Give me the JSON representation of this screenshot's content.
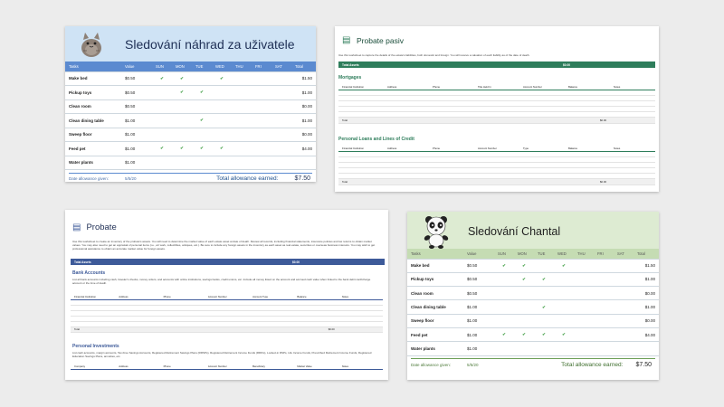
{
  "card1": {
    "title": "Sledování náhrad za uživatele",
    "columns": [
      "Tasks",
      "Value",
      "SUN",
      "MON",
      "TUE",
      "WED",
      "THU",
      "FRI",
      "SAT",
      "Total"
    ],
    "rows": [
      {
        "task": "Make bed",
        "value": "$0.50",
        "checks": [
          true,
          true,
          false,
          true,
          false,
          false,
          false
        ],
        "total": "$1.50"
      },
      {
        "task": "Pickup toys",
        "value": "$0.50",
        "checks": [
          false,
          true,
          true,
          false,
          false,
          false,
          false
        ],
        "total": "$1.00"
      },
      {
        "task": "Clean room",
        "value": "$0.50",
        "checks": [
          false,
          false,
          false,
          false,
          false,
          false,
          false
        ],
        "total": "$0.00"
      },
      {
        "task": "Clean dining table",
        "value": "$1.00",
        "checks": [
          false,
          false,
          true,
          false,
          false,
          false,
          false
        ],
        "total": "$1.00"
      },
      {
        "task": "Sweep floor",
        "value": "$1.00",
        "checks": [
          false,
          false,
          false,
          false,
          false,
          false,
          false
        ],
        "total": "$0.00"
      },
      {
        "task": "Feed pet",
        "value": "$1.00",
        "checks": [
          true,
          true,
          true,
          true,
          false,
          false,
          false
        ],
        "total": "$4.00"
      },
      {
        "task": "Water plants",
        "value": "$1.00",
        "checks": [
          false,
          false,
          false,
          false,
          false,
          false,
          false
        ],
        "total": ""
      }
    ],
    "date_label": "Date allowance given:",
    "date_value": "5/5/20",
    "total_label": "Total allowance earned:",
    "total_value": "$7.50",
    "accent": "#5b8ad0"
  },
  "card2": {
    "title": "Probate pasiv",
    "intro": "Use this worksheet to capture the details of the estate's liabilities, both domestic and foreign. You will receive a valuation of each liability as of the date of death.",
    "bar_label": "Total Assets",
    "bar_value": "$0.00",
    "mortgages_title": "Mortgages",
    "mortgages_cols": [
      "Financial Institution",
      "Address",
      "Phone",
      "Title Held In",
      "Account Number",
      "Balance",
      "Notes"
    ],
    "mortgages_total_label": "Total",
    "mortgages_total_value": "$0.00",
    "loans_title": "Personal Loans and Lines of Credit",
    "loans_cols": [
      "Financial Institution",
      "Address",
      "Phone",
      "Account Number",
      "Type",
      "Balance",
      "Notes"
    ],
    "loans_total_label": "Total",
    "loans_total_value": "$0.00",
    "accent": "#2e7d5b"
  },
  "card3": {
    "title": "Probate",
    "intro": "Use this worksheet to create an inventory of the probate's assets. You will need to determine the market value of each estate asset at date of death. Review all records, including financial statements, insurance policies and tax returns to obtain market values. You may also need to get an appraisal of personal items (i.e., art work, collectibles, antiques, etc.). Be sure to include any foreign assets in the inventory as each asset as real estate, securities or overseas business interests. You may wish to get professional assistance to obtain an accurate market value for foreign assets.",
    "bar_label": "Total Assets",
    "bar_value": "$0.00",
    "bank_title": "Bank Accounts",
    "bank_desc": "List all bank accounts including cash, traveler's checks, money orders, and accounts with online institutions, savings banks, credit unions, etc. Include all money listed on the account and accrued cash value when linked to the bank debit card/charge account or the time of death.",
    "bank_cols": [
      "Financial Institution",
      "Address",
      "Phone",
      "Account Number",
      "Account Type",
      "Balance",
      "Notes"
    ],
    "bank_total_label": "Total",
    "bank_total_value": "$0.00",
    "invest_title": "Personal Investments",
    "invest_desc": "List cash accounts, margin accounts, Tax-Free Savings Accounts, Registered Retirement Savings Plans (RRSPs), Registered Retirement Income Funds (RRIFs), Locked-in RSPs, Life Income Funds, Prescribed Retirement Income Funds, Registered Education Savings Plans, annuities, etc.",
    "invest_cols": [
      "Company",
      "Address",
      "Phone",
      "Account Number",
      "Beneficiary",
      "Market Value",
      "Notes"
    ],
    "accent": "#3d5a99"
  },
  "card4": {
    "title": "Sledování Chantal",
    "columns": [
      "Tasks",
      "Value",
      "SUN",
      "MON",
      "TUE",
      "WED",
      "THU",
      "FRI",
      "SAT",
      "Total"
    ],
    "rows": [
      {
        "task": "Make bed",
        "value": "$0.50",
        "checks": [
          true,
          true,
          false,
          true,
          false,
          false,
          false
        ],
        "total": "$1.50"
      },
      {
        "task": "Pickup toys",
        "value": "$0.50",
        "checks": [
          false,
          true,
          true,
          false,
          false,
          false,
          false
        ],
        "total": "$1.00"
      },
      {
        "task": "Clean room",
        "value": "$0.50",
        "checks": [
          false,
          false,
          false,
          false,
          false,
          false,
          false
        ],
        "total": "$0.00"
      },
      {
        "task": "Clean dining table",
        "value": "$1.00",
        "checks": [
          false,
          false,
          true,
          false,
          false,
          false,
          false
        ],
        "total": "$1.00"
      },
      {
        "task": "Sweep floor",
        "value": "$1.00",
        "checks": [
          false,
          false,
          false,
          false,
          false,
          false,
          false
        ],
        "total": "$0.00"
      },
      {
        "task": "Feed pet",
        "value": "$1.00",
        "checks": [
          true,
          true,
          true,
          true,
          false,
          false,
          false
        ],
        "total": "$4.00"
      },
      {
        "task": "Water plants",
        "value": "$1.00",
        "checks": [
          false,
          false,
          false,
          false,
          false,
          false,
          false
        ],
        "total": ""
      }
    ],
    "date_label": "Date allowance given:",
    "date_value": "5/5/20",
    "total_label": "Total allowance earned:",
    "total_value": "$7.50",
    "accent": "#6b9e55"
  },
  "icons": {
    "check": "✔",
    "card1_image": "cat-illustration-icon",
    "card2_image": "document-icon",
    "card3_image": "document-icon",
    "card4_image": "panda-illustration-icon"
  }
}
